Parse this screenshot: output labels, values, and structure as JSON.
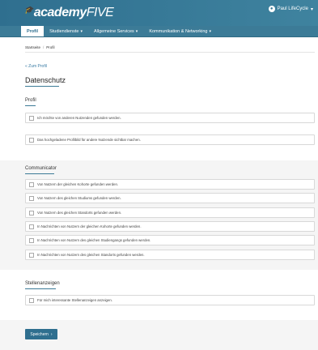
{
  "header": {
    "logo_hat": "🎓",
    "logo_bold": "academy",
    "logo_light": "FIVE",
    "user_name": "Paul LifeCycle",
    "user_chevron": "▾"
  },
  "nav": {
    "items": [
      {
        "label": "Profil",
        "chevron": ""
      },
      {
        "label": "Studiendienste",
        "chevron": "▾"
      },
      {
        "label": "Allgemeine Services",
        "chevron": "▾"
      },
      {
        "label": "Kommunikation & Networking",
        "chevron": "▾"
      }
    ]
  },
  "breadcrumb": {
    "home": "Startseite",
    "separator": "/",
    "current": "Profil"
  },
  "back_link": "« Zum Profil",
  "page_title": "Datenschutz",
  "sections": {
    "profil": {
      "title": "Profil",
      "options": [
        "Ich möchte von anderen Nutzenden gefunden werden.",
        "Das hochgeladene Profilbild für andere Nutzende sichtbar machen."
      ]
    },
    "communicator": {
      "title": "Communicator",
      "options": [
        "Von Nutzern der gleichen Kohorte gefunden werden.",
        "Von Nutzern des gleichen Studiums gefunden werden.",
        "Von Nutzern des gleichen Standorts gefunden werden.",
        "In Nachrichten von Nutzern der gleichen Kohorte gefunden werden.",
        "In Nachrichten von Nutzern des gleichen Studiengangs gefunden werden.",
        "In Nachrichten von Nutzern des gleichen Standorts gefunden werden."
      ]
    },
    "stellenanzeigen": {
      "title": "Stellenanzeigen",
      "options": [
        "Für mich interessante Stellenanzeigen anzeigen."
      ]
    }
  },
  "save_button": {
    "label": "Speichern",
    "icon": "›"
  }
}
